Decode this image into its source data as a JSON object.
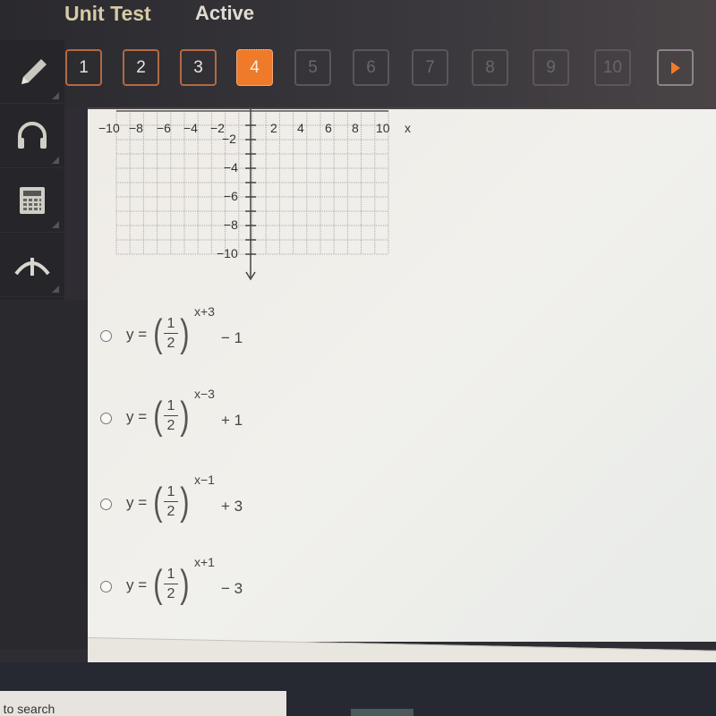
{
  "header": {
    "title": "Unit Test",
    "status": "Active"
  },
  "question_nav": {
    "buttons": [
      {
        "label": "1",
        "state": "answered"
      },
      {
        "label": "2",
        "state": "answered"
      },
      {
        "label": "3",
        "state": "answered"
      },
      {
        "label": "4",
        "state": "active"
      },
      {
        "label": "5",
        "state": "disabled"
      },
      {
        "label": "6",
        "state": "disabled"
      },
      {
        "label": "7",
        "state": "disabled"
      },
      {
        "label": "8",
        "state": "disabled"
      },
      {
        "label": "9",
        "state": "disabled"
      },
      {
        "label": "10",
        "state": "disabled"
      }
    ],
    "next_icon": "play-arrow-icon",
    "active_color": "#ee7a2a"
  },
  "sidebar": {
    "tools": [
      {
        "name": "pencil",
        "icon": "pencil-icon"
      },
      {
        "name": "audio",
        "icon": "headphones-icon"
      },
      {
        "name": "calculator",
        "icon": "calculator-icon"
      },
      {
        "name": "reference",
        "icon": "arrow-up-icon"
      }
    ]
  },
  "graph": {
    "x_ticks": [
      "−10",
      "−8",
      "−6",
      "−4",
      "−2",
      "2",
      "4",
      "6",
      "8",
      "10"
    ],
    "x_label": "x",
    "y_ticks": [
      "−2",
      "−4",
      "−6",
      "−8",
      "−10"
    ]
  },
  "choices": [
    {
      "base_num": "1",
      "base_den": "2",
      "exponent": "x+3",
      "constant": "− 1"
    },
    {
      "base_num": "1",
      "base_den": "2",
      "exponent": "x−3",
      "constant": "+ 1"
    },
    {
      "base_num": "1",
      "base_den": "2",
      "exponent": "x−1",
      "constant": "+ 3"
    },
    {
      "base_num": "1",
      "base_den": "2",
      "exponent": "x+1",
      "constant": "− 3"
    }
  ],
  "choice_prefix": "y =",
  "taskbar": {
    "search_text": "e to search"
  }
}
